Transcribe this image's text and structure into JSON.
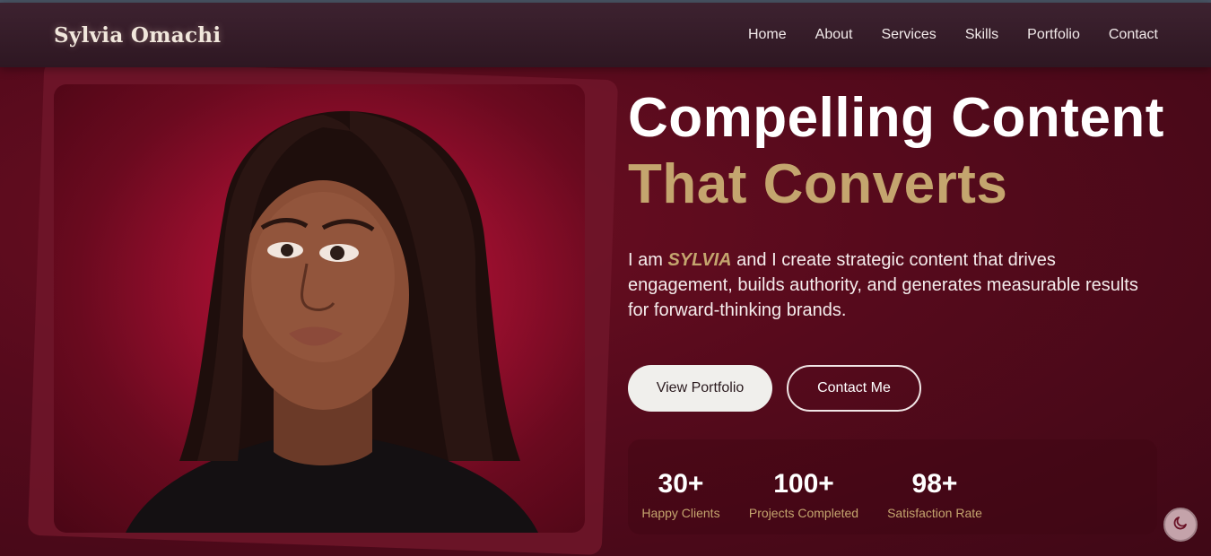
{
  "brand": {
    "name": "Sylvia Omachi"
  },
  "nav": {
    "items": [
      {
        "label": "Home"
      },
      {
        "label": "About"
      },
      {
        "label": "Services"
      },
      {
        "label": "Skills"
      },
      {
        "label": "Portfolio"
      },
      {
        "label": "Contact"
      }
    ]
  },
  "hero": {
    "title_line1": "Compelling Content",
    "title_line2": "That Converts",
    "desc_prefix": "I am",
    "desc_name": "SYLVIA",
    "desc_rest": "and I create strategic content that drives engagement, builds authority, and generates measurable results for forward-thinking brands.",
    "primary_button": "View Portfolio",
    "secondary_button": "Contact Me"
  },
  "stats": [
    {
      "value": "30+",
      "label": "Happy Clients"
    },
    {
      "value": "100+",
      "label": "Projects Completed"
    },
    {
      "value": "98+",
      "label": "Satisfaction Rate"
    }
  ],
  "icons": {
    "theme_toggle": "moon-icon",
    "portrait": "profile-photo"
  },
  "colors": {
    "accent_gold": "#c4a56e",
    "background": "#560a1c",
    "header": "#2e1722"
  }
}
